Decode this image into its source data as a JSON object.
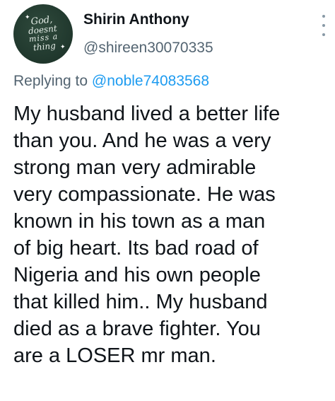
{
  "author": {
    "display_name": "Shirin Anthony",
    "handle": "@shireen30070335",
    "avatar_text": {
      "line1": "God,",
      "line2": "doesnt",
      "line3": "miss a",
      "line4": "thing"
    },
    "avatar_colors": {
      "background": "#223a2f",
      "text": "#e6eee8"
    }
  },
  "reply": {
    "prefix": "Replying to",
    "target": "@noble74083568"
  },
  "tweet": {
    "text": "My husband lived a better life\nthan you. And he was a very\nstrong man very admirable\nvery compassionate. He was\nknown in his town as a man\nof big heart. Its bad road of\nNigeria and his own people\nthat killed him.. My husband\ndied as a brave fighter. You\nare a LOSER mr man."
  },
  "icons": {
    "more": "more-vertical-icon",
    "stars": "star-icon"
  },
  "colors": {
    "primary_text": "#0f1419",
    "secondary_text": "#536471",
    "link": "#1d9bf0"
  }
}
